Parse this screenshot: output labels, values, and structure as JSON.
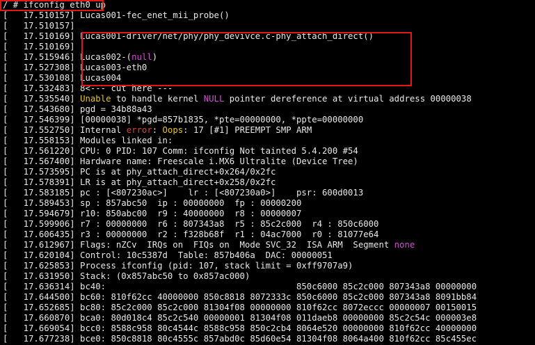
{
  "terminal": {
    "colors": {
      "background": "#000000",
      "foreground": "#e8e8e8",
      "magenta": "#d24bd2",
      "red": "#e83a3a",
      "yellow": "#e8c020",
      "highlight_box": "#e01818"
    },
    "lines": [
      [
        {
          "t": "/ # ifconfig eth0 up",
          "c": "fg"
        }
      ],
      [
        {
          "t": "[   17.510157] Lucas001-fec_enet_mii_probe()",
          "c": "fg"
        }
      ],
      [
        {
          "t": "[   17.510157]",
          "c": "fg"
        }
      ],
      [
        {
          "t": "[   17.510169] Lucas001-driver/net/phy/phy_devivce.c-phy_attach_direct()",
          "c": "fg"
        }
      ],
      [
        {
          "t": "[   17.510169]",
          "c": "fg"
        }
      ],
      [
        {
          "t": "[   17.515946] Lucas002-(",
          "c": "fg"
        },
        {
          "t": "null",
          "c": "magenta"
        },
        {
          "t": ")",
          "c": "fg"
        }
      ],
      [
        {
          "t": "[   17.527308] Lucas003-eth0",
          "c": "fg"
        }
      ],
      [
        {
          "t": "[   17.530108] Lucas004",
          "c": "fg"
        }
      ],
      [
        {
          "t": "[   17.532483] 8<--- cut here ---",
          "c": "fg"
        }
      ],
      [
        {
          "t": "[   17.535540] ",
          "c": "fg"
        },
        {
          "t": "Unable",
          "c": "yellow"
        },
        {
          "t": " to handle kernel ",
          "c": "fg"
        },
        {
          "t": "NULL",
          "c": "magenta"
        },
        {
          "t": " pointer dereference at virtual address 00000038",
          "c": "fg"
        }
      ],
      [
        {
          "t": "[   17.543680] pgd = 34b88a43",
          "c": "fg"
        }
      ],
      [
        {
          "t": "[   17.546399] [00000038] *pgd=857b1835, *pte=00000000, *ppte=00000000",
          "c": "fg"
        }
      ],
      [
        {
          "t": "[   17.552750] Internal ",
          "c": "fg"
        },
        {
          "t": "error",
          "c": "red"
        },
        {
          "t": ": ",
          "c": "fg"
        },
        {
          "t": "Oops",
          "c": "yellow"
        },
        {
          "t": ": 17 [#1] PREEMPT SMP ARM",
          "c": "fg"
        }
      ],
      [
        {
          "t": "[   17.558153] Modules linked in:",
          "c": "fg"
        }
      ],
      [
        {
          "t": "[   17.561220] CPU: 0 PID: 107 Comm: ifconfig Not tainted 5.4.200 #54",
          "c": "fg"
        }
      ],
      [
        {
          "t": "[   17.567400] Hardware name: Freescale i.MX6 Ultralite (Device Tree)",
          "c": "fg"
        }
      ],
      [
        {
          "t": "[   17.573595] PC is at phy_attach_direct+0x264/0x2fc",
          "c": "fg"
        }
      ],
      [
        {
          "t": "[   17.578391] LR is at phy_attach_direct+0x258/0x2fc",
          "c": "fg"
        }
      ],
      [
        {
          "t": "[   17.583185] pc : [<807230ac>]    lr : [<807230a0>]    psr: 600d0013",
          "c": "fg"
        }
      ],
      [
        {
          "t": "[   17.589453] sp : 857abc50  ip : 00000000  fp : 00000200",
          "c": "fg"
        }
      ],
      [
        {
          "t": "[   17.594679] r10: 850abc00  r9 : 40000000  r8 : 00000007",
          "c": "fg"
        }
      ],
      [
        {
          "t": "[   17.599906] r7 : 00000000  r6 : 807343a8  r5 : 85c2c000  r4 : 850c6000",
          "c": "fg"
        }
      ],
      [
        {
          "t": "[   17.606435] r3 : 00000000  r2 : f328b68f  r1 : 04ac7000  r0 : 81077e64",
          "c": "fg"
        }
      ],
      [
        {
          "t": "[   17.612967] Flags: nZCv  IRQs on  FIQs on  Mode SVC_32  ISA ARM  Segment ",
          "c": "fg"
        },
        {
          "t": "none",
          "c": "magenta"
        }
      ],
      [
        {
          "t": "[   17.620104] Control: 10c5387d  Table: 857b406a  DAC: 00000051",
          "c": "fg"
        }
      ],
      [
        {
          "t": "[   17.625853] Process ifconfig (pid: 107, stack limit = 0xff9707a9)",
          "c": "fg"
        }
      ],
      [
        {
          "t": "[   17.631950] Stack: (0x857abc50 to 0x857ac000)",
          "c": "fg"
        }
      ],
      [
        {
          "t": "[   17.636314] bc40:                                     850c6000 85c2c000 807343a8 00000000",
          "c": "fg"
        }
      ],
      [
        {
          "t": "[   17.644500] bc60: 810f62cc 40000000 850c8818 8072333c 850c6000 85c2c000 807343a8 8091bb84",
          "c": "fg"
        }
      ],
      [
        {
          "t": "[   17.652685] bc80: 85c2c000 85c2c000 81304f08 00000000 810f62cc 8072eccc 00000007 00150015",
          "c": "fg"
        }
      ],
      [
        {
          "t": "[   17.660870] bca0: 80d018c4 85c2c540 00000001 81304f08 011daeb8 00000000 85c2c54c 000003e8",
          "c": "fg"
        }
      ],
      [
        {
          "t": "[   17.669054] bcc0: 8588c958 80c4544c 8588c958 850c2cb4 8064e520 00000000 810f62cc 40000000",
          "c": "fg"
        }
      ],
      [
        {
          "t": "[   17.677238] bce0: 850c8818 80c4555c 857abd0c 85d60e54 81304f08 8064a400 810f62cc 85c455ec",
          "c": "fg"
        }
      ]
    ]
  }
}
